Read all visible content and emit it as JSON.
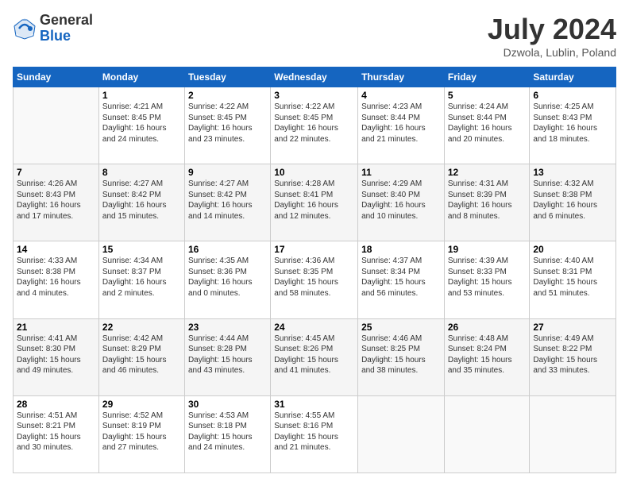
{
  "logo": {
    "general": "General",
    "blue": "Blue"
  },
  "title": "July 2024",
  "location": "Dzwola, Lublin, Poland",
  "days_of_week": [
    "Sunday",
    "Monday",
    "Tuesday",
    "Wednesday",
    "Thursday",
    "Friday",
    "Saturday"
  ],
  "weeks": [
    [
      {
        "day": "",
        "info": ""
      },
      {
        "day": "1",
        "info": "Sunrise: 4:21 AM\nSunset: 8:45 PM\nDaylight: 16 hours\nand 24 minutes."
      },
      {
        "day": "2",
        "info": "Sunrise: 4:22 AM\nSunset: 8:45 PM\nDaylight: 16 hours\nand 23 minutes."
      },
      {
        "day": "3",
        "info": "Sunrise: 4:22 AM\nSunset: 8:45 PM\nDaylight: 16 hours\nand 22 minutes."
      },
      {
        "day": "4",
        "info": "Sunrise: 4:23 AM\nSunset: 8:44 PM\nDaylight: 16 hours\nand 21 minutes."
      },
      {
        "day": "5",
        "info": "Sunrise: 4:24 AM\nSunset: 8:44 PM\nDaylight: 16 hours\nand 20 minutes."
      },
      {
        "day": "6",
        "info": "Sunrise: 4:25 AM\nSunset: 8:43 PM\nDaylight: 16 hours\nand 18 minutes."
      }
    ],
    [
      {
        "day": "7",
        "info": "Sunrise: 4:26 AM\nSunset: 8:43 PM\nDaylight: 16 hours\nand 17 minutes."
      },
      {
        "day": "8",
        "info": "Sunrise: 4:27 AM\nSunset: 8:42 PM\nDaylight: 16 hours\nand 15 minutes."
      },
      {
        "day": "9",
        "info": "Sunrise: 4:27 AM\nSunset: 8:42 PM\nDaylight: 16 hours\nand 14 minutes."
      },
      {
        "day": "10",
        "info": "Sunrise: 4:28 AM\nSunset: 8:41 PM\nDaylight: 16 hours\nand 12 minutes."
      },
      {
        "day": "11",
        "info": "Sunrise: 4:29 AM\nSunset: 8:40 PM\nDaylight: 16 hours\nand 10 minutes."
      },
      {
        "day": "12",
        "info": "Sunrise: 4:31 AM\nSunset: 8:39 PM\nDaylight: 16 hours\nand 8 minutes."
      },
      {
        "day": "13",
        "info": "Sunrise: 4:32 AM\nSunset: 8:38 PM\nDaylight: 16 hours\nand 6 minutes."
      }
    ],
    [
      {
        "day": "14",
        "info": "Sunrise: 4:33 AM\nSunset: 8:38 PM\nDaylight: 16 hours\nand 4 minutes."
      },
      {
        "day": "15",
        "info": "Sunrise: 4:34 AM\nSunset: 8:37 PM\nDaylight: 16 hours\nand 2 minutes."
      },
      {
        "day": "16",
        "info": "Sunrise: 4:35 AM\nSunset: 8:36 PM\nDaylight: 16 hours\nand 0 minutes."
      },
      {
        "day": "17",
        "info": "Sunrise: 4:36 AM\nSunset: 8:35 PM\nDaylight: 15 hours\nand 58 minutes."
      },
      {
        "day": "18",
        "info": "Sunrise: 4:37 AM\nSunset: 8:34 PM\nDaylight: 15 hours\nand 56 minutes."
      },
      {
        "day": "19",
        "info": "Sunrise: 4:39 AM\nSunset: 8:33 PM\nDaylight: 15 hours\nand 53 minutes."
      },
      {
        "day": "20",
        "info": "Sunrise: 4:40 AM\nSunset: 8:31 PM\nDaylight: 15 hours\nand 51 minutes."
      }
    ],
    [
      {
        "day": "21",
        "info": "Sunrise: 4:41 AM\nSunset: 8:30 PM\nDaylight: 15 hours\nand 49 minutes."
      },
      {
        "day": "22",
        "info": "Sunrise: 4:42 AM\nSunset: 8:29 PM\nDaylight: 15 hours\nand 46 minutes."
      },
      {
        "day": "23",
        "info": "Sunrise: 4:44 AM\nSunset: 8:28 PM\nDaylight: 15 hours\nand 43 minutes."
      },
      {
        "day": "24",
        "info": "Sunrise: 4:45 AM\nSunset: 8:26 PM\nDaylight: 15 hours\nand 41 minutes."
      },
      {
        "day": "25",
        "info": "Sunrise: 4:46 AM\nSunset: 8:25 PM\nDaylight: 15 hours\nand 38 minutes."
      },
      {
        "day": "26",
        "info": "Sunrise: 4:48 AM\nSunset: 8:24 PM\nDaylight: 15 hours\nand 35 minutes."
      },
      {
        "day": "27",
        "info": "Sunrise: 4:49 AM\nSunset: 8:22 PM\nDaylight: 15 hours\nand 33 minutes."
      }
    ],
    [
      {
        "day": "28",
        "info": "Sunrise: 4:51 AM\nSunset: 8:21 PM\nDaylight: 15 hours\nand 30 minutes."
      },
      {
        "day": "29",
        "info": "Sunrise: 4:52 AM\nSunset: 8:19 PM\nDaylight: 15 hours\nand 27 minutes."
      },
      {
        "day": "30",
        "info": "Sunrise: 4:53 AM\nSunset: 8:18 PM\nDaylight: 15 hours\nand 24 minutes."
      },
      {
        "day": "31",
        "info": "Sunrise: 4:55 AM\nSunset: 8:16 PM\nDaylight: 15 hours\nand 21 minutes."
      },
      {
        "day": "",
        "info": ""
      },
      {
        "day": "",
        "info": ""
      },
      {
        "day": "",
        "info": ""
      }
    ]
  ]
}
